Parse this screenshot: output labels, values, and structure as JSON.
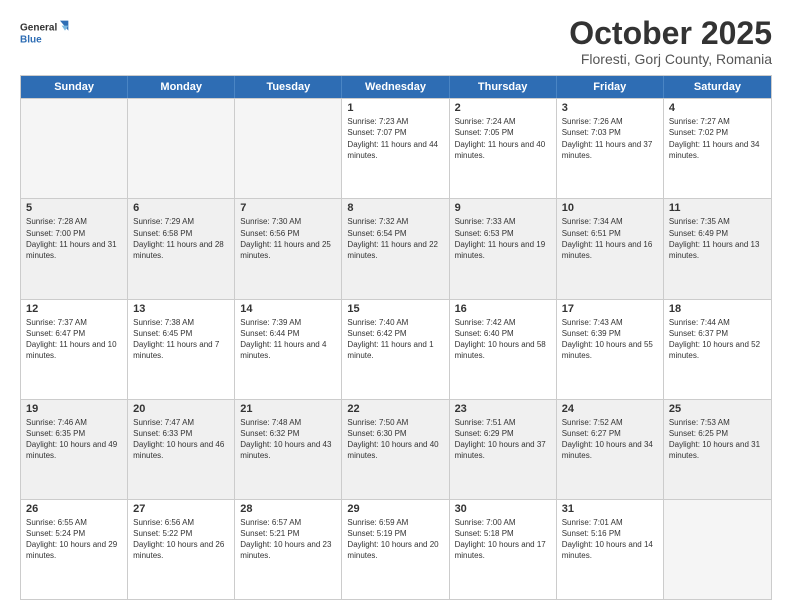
{
  "header": {
    "logo_general": "General",
    "logo_blue": "Blue",
    "month_title": "October 2025",
    "location": "Floresti, Gorj County, Romania"
  },
  "days_of_week": [
    "Sunday",
    "Monday",
    "Tuesday",
    "Wednesday",
    "Thursday",
    "Friday",
    "Saturday"
  ],
  "rows": [
    {
      "cells": [
        {
          "day": "",
          "empty": true
        },
        {
          "day": "",
          "empty": true
        },
        {
          "day": "",
          "empty": true
        },
        {
          "day": "1",
          "sunrise": "7:23 AM",
          "sunset": "7:07 PM",
          "daylight": "11 hours and 44 minutes."
        },
        {
          "day": "2",
          "sunrise": "7:24 AM",
          "sunset": "7:05 PM",
          "daylight": "11 hours and 40 minutes."
        },
        {
          "day": "3",
          "sunrise": "7:26 AM",
          "sunset": "7:03 PM",
          "daylight": "11 hours and 37 minutes."
        },
        {
          "day": "4",
          "sunrise": "7:27 AM",
          "sunset": "7:02 PM",
          "daylight": "11 hours and 34 minutes."
        }
      ]
    },
    {
      "cells": [
        {
          "day": "5",
          "sunrise": "7:28 AM",
          "sunset": "7:00 PM",
          "daylight": "11 hours and 31 minutes."
        },
        {
          "day": "6",
          "sunrise": "7:29 AM",
          "sunset": "6:58 PM",
          "daylight": "11 hours and 28 minutes."
        },
        {
          "day": "7",
          "sunrise": "7:30 AM",
          "sunset": "6:56 PM",
          "daylight": "11 hours and 25 minutes."
        },
        {
          "day": "8",
          "sunrise": "7:32 AM",
          "sunset": "6:54 PM",
          "daylight": "11 hours and 22 minutes."
        },
        {
          "day": "9",
          "sunrise": "7:33 AM",
          "sunset": "6:53 PM",
          "daylight": "11 hours and 19 minutes."
        },
        {
          "day": "10",
          "sunrise": "7:34 AM",
          "sunset": "6:51 PM",
          "daylight": "11 hours and 16 minutes."
        },
        {
          "day": "11",
          "sunrise": "7:35 AM",
          "sunset": "6:49 PM",
          "daylight": "11 hours and 13 minutes."
        }
      ]
    },
    {
      "cells": [
        {
          "day": "12",
          "sunrise": "7:37 AM",
          "sunset": "6:47 PM",
          "daylight": "11 hours and 10 minutes."
        },
        {
          "day": "13",
          "sunrise": "7:38 AM",
          "sunset": "6:45 PM",
          "daylight": "11 hours and 7 minutes."
        },
        {
          "day": "14",
          "sunrise": "7:39 AM",
          "sunset": "6:44 PM",
          "daylight": "11 hours and 4 minutes."
        },
        {
          "day": "15",
          "sunrise": "7:40 AM",
          "sunset": "6:42 PM",
          "daylight": "11 hours and 1 minute."
        },
        {
          "day": "16",
          "sunrise": "7:42 AM",
          "sunset": "6:40 PM",
          "daylight": "10 hours and 58 minutes."
        },
        {
          "day": "17",
          "sunrise": "7:43 AM",
          "sunset": "6:39 PM",
          "daylight": "10 hours and 55 minutes."
        },
        {
          "day": "18",
          "sunrise": "7:44 AM",
          "sunset": "6:37 PM",
          "daylight": "10 hours and 52 minutes."
        }
      ]
    },
    {
      "cells": [
        {
          "day": "19",
          "sunrise": "7:46 AM",
          "sunset": "6:35 PM",
          "daylight": "10 hours and 49 minutes."
        },
        {
          "day": "20",
          "sunrise": "7:47 AM",
          "sunset": "6:33 PM",
          "daylight": "10 hours and 46 minutes."
        },
        {
          "day": "21",
          "sunrise": "7:48 AM",
          "sunset": "6:32 PM",
          "daylight": "10 hours and 43 minutes."
        },
        {
          "day": "22",
          "sunrise": "7:50 AM",
          "sunset": "6:30 PM",
          "daylight": "10 hours and 40 minutes."
        },
        {
          "day": "23",
          "sunrise": "7:51 AM",
          "sunset": "6:29 PM",
          "daylight": "10 hours and 37 minutes."
        },
        {
          "day": "24",
          "sunrise": "7:52 AM",
          "sunset": "6:27 PM",
          "daylight": "10 hours and 34 minutes."
        },
        {
          "day": "25",
          "sunrise": "7:53 AM",
          "sunset": "6:25 PM",
          "daylight": "10 hours and 31 minutes."
        }
      ]
    },
    {
      "cells": [
        {
          "day": "26",
          "sunrise": "6:55 AM",
          "sunset": "5:24 PM",
          "daylight": "10 hours and 29 minutes."
        },
        {
          "day": "27",
          "sunrise": "6:56 AM",
          "sunset": "5:22 PM",
          "daylight": "10 hours and 26 minutes."
        },
        {
          "day": "28",
          "sunrise": "6:57 AM",
          "sunset": "5:21 PM",
          "daylight": "10 hours and 23 minutes."
        },
        {
          "day": "29",
          "sunrise": "6:59 AM",
          "sunset": "5:19 PM",
          "daylight": "10 hours and 20 minutes."
        },
        {
          "day": "30",
          "sunrise": "7:00 AM",
          "sunset": "5:18 PM",
          "daylight": "10 hours and 17 minutes."
        },
        {
          "day": "31",
          "sunrise": "7:01 AM",
          "sunset": "5:16 PM",
          "daylight": "10 hours and 14 minutes."
        },
        {
          "day": "",
          "empty": true
        }
      ]
    }
  ]
}
